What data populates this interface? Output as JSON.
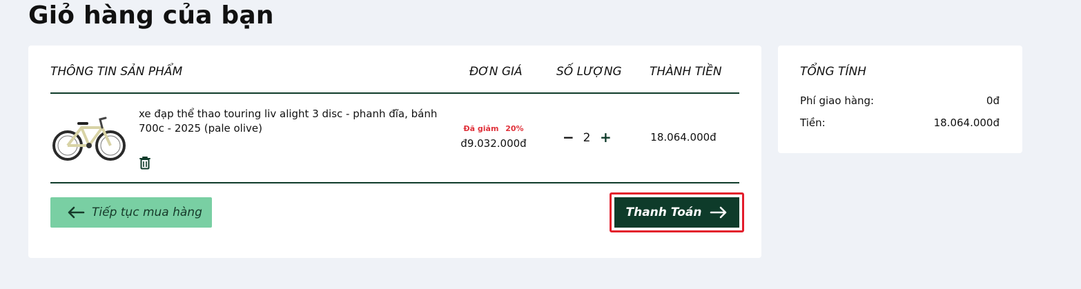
{
  "page": {
    "title": "Giỏ hàng của bạn"
  },
  "table": {
    "headers": {
      "product_info": "THÔNG TIN SẢN PHẨM",
      "unit_price": "ĐƠN GIÁ",
      "quantity": "SỐ LƯỢNG",
      "total": "THÀNH TIỀN"
    }
  },
  "cart_item": {
    "name": "xe đạp thể thao touring liv alight 3 disc - phanh đĩa, bánh 700c - 2025 (pale olive)",
    "discount_label": "Đã giảm",
    "discount_percent": "20%",
    "unit_price": "đ9.032.000đ",
    "quantity": "2",
    "line_total": "18.064.000đ",
    "image_icon": "bicycle-product-image",
    "delete_icon": "trash-icon"
  },
  "quantity_controls": {
    "minus": "−",
    "plus": "+"
  },
  "actions": {
    "continue_label": "Tiếp tục mua hàng",
    "checkout_label": "Thanh Toán"
  },
  "summary": {
    "title": "TỔNG TÍNH",
    "shipping_label": "Phí giao hàng:",
    "shipping_value": "0đ",
    "money_label": "Tiền:",
    "money_value": "18.064.000đ"
  },
  "colors": {
    "accent_dark": "#0e3b2a",
    "accent_light": "#79cfa3",
    "discount_red": "#e0313a",
    "highlight_red": "#e31b2b",
    "background": "#eff2f7"
  }
}
